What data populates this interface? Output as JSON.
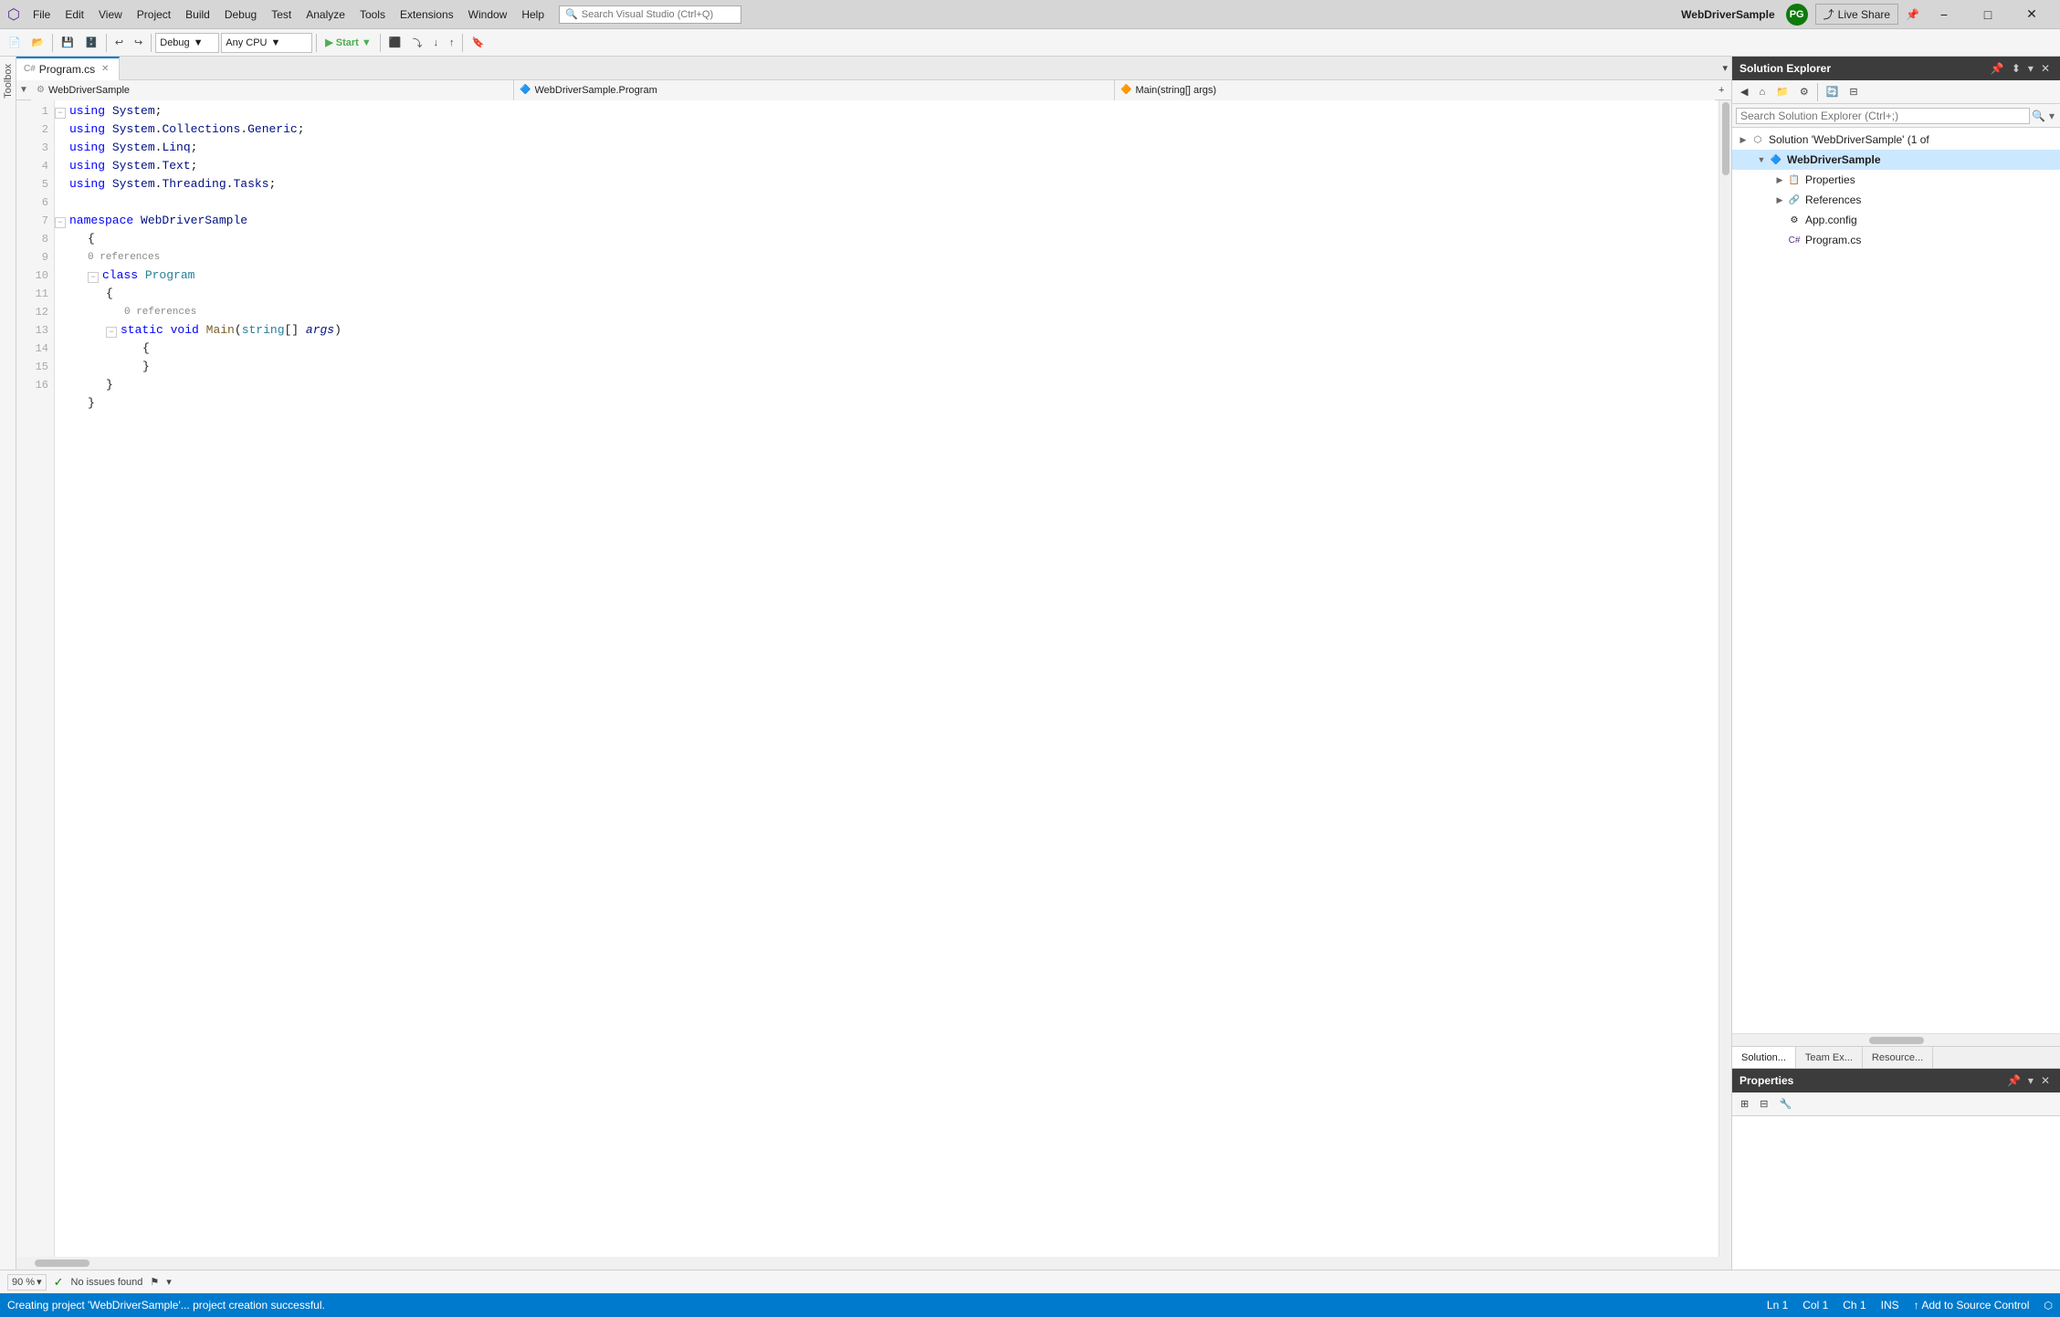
{
  "title_bar": {
    "app_title": "WebDriverSample",
    "logo_label": "Visual Studio",
    "user_initials": "PG",
    "live_share_label": "Live Share",
    "min_btn": "−",
    "max_btn": "□",
    "close_btn": "✕"
  },
  "menu": {
    "items": [
      "File",
      "Edit",
      "View",
      "Project",
      "Build",
      "Debug",
      "Test",
      "Analyze",
      "Tools",
      "Extensions",
      "Window",
      "Help"
    ]
  },
  "toolbar": {
    "debug_config": "Debug",
    "platform_config": "Any CPU",
    "start_btn": "▶ Start ▼",
    "search_placeholder": "Search Visual Studio (Ctrl+Q)"
  },
  "editor": {
    "tab_label": "Program.cs",
    "breadcrumb_project": "WebDriverSample",
    "breadcrumb_class": "WebDriverSample.Program",
    "breadcrumb_method": "Main(string[] args)",
    "code_lines": [
      {
        "num": 1,
        "indent": 0,
        "collapse": true,
        "content": "using System;"
      },
      {
        "num": 2,
        "indent": 0,
        "collapse": false,
        "content": "using System.Collections.Generic;"
      },
      {
        "num": 3,
        "indent": 0,
        "collapse": false,
        "content": "using System.Linq;"
      },
      {
        "num": 4,
        "indent": 0,
        "collapse": false,
        "content": "using System.Text;"
      },
      {
        "num": 5,
        "indent": 0,
        "collapse": false,
        "content": "using System.Threading.Tasks;"
      },
      {
        "num": 6,
        "indent": 0,
        "collapse": false,
        "content": ""
      },
      {
        "num": 7,
        "indent": 0,
        "collapse": true,
        "content": "namespace WebDriverSample"
      },
      {
        "num": 8,
        "indent": 1,
        "collapse": false,
        "content": "{"
      },
      {
        "num": 9,
        "indent": 1,
        "collapse": true,
        "content": "class Program",
        "ref": "0 references"
      },
      {
        "num": 10,
        "indent": 2,
        "collapse": false,
        "content": "{"
      },
      {
        "num": 11,
        "indent": 2,
        "collapse": true,
        "content": "static void Main(string[] args)",
        "ref": "0 references"
      },
      {
        "num": 12,
        "indent": 3,
        "collapse": false,
        "content": "{"
      },
      {
        "num": 13,
        "indent": 3,
        "collapse": false,
        "content": "}"
      },
      {
        "num": 14,
        "indent": 2,
        "collapse": false,
        "content": "}"
      },
      {
        "num": 15,
        "indent": 1,
        "collapse": false,
        "content": "}"
      },
      {
        "num": 16,
        "indent": 0,
        "collapse": false,
        "content": ""
      }
    ]
  },
  "solution_explorer": {
    "panel_title": "Solution Explorer",
    "search_placeholder": "Search Solution Explorer (Ctrl+;)",
    "tree": {
      "solution_label": "Solution 'WebDriverSample' (1 of",
      "project_label": "WebDriverSample",
      "items": [
        {
          "label": "Properties",
          "indent": 2,
          "expanded": false
        },
        {
          "label": "References",
          "indent": 2,
          "expanded": false
        },
        {
          "label": "App.config",
          "indent": 2,
          "expanded": false
        },
        {
          "label": "Program.cs",
          "indent": 2,
          "expanded": false
        }
      ]
    },
    "panel_tabs": [
      "Solution...",
      "Team Ex...",
      "Resource..."
    ]
  },
  "properties": {
    "panel_title": "Properties"
  },
  "status_bar": {
    "message": "Creating project 'WebDriverSample'... project creation successful.",
    "ln": "Ln 1",
    "col": "Col 1",
    "ch": "Ch 1",
    "ins": "INS",
    "source_control": "↑ Add to Source Control"
  },
  "bottom_bar": {
    "zoom": "90 %",
    "issues": "No issues found"
  },
  "colors": {
    "accent": "#007acc",
    "tab_active_border": "#007acc",
    "title_bg": "#d6d6d6",
    "menu_bg": "#f5f5f5",
    "panel_title_bg": "#3c3c3c",
    "status_bar_bg": "#007acc",
    "keyword": "#0000ff",
    "classname": "#267f99",
    "identifier": "#001080",
    "method": "#795e26"
  }
}
